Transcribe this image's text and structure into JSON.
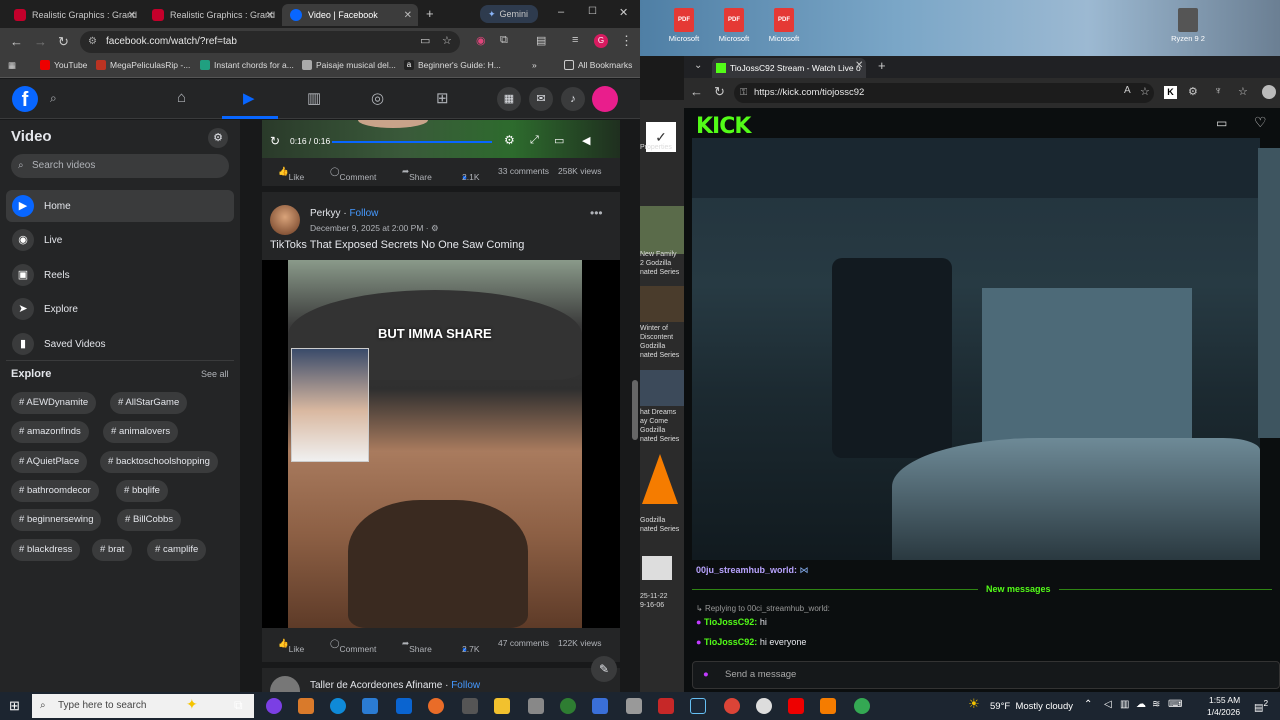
{
  "left_browser": {
    "tabs": [
      {
        "label": "Realistic Graphics : Grand",
        "color": "#c4002b"
      },
      {
        "label": "Realistic Graphics : Grand",
        "color": "#c4002b"
      },
      {
        "label": "Video | Facebook",
        "color": "#0866ff"
      },
      {
        "label": "Gemini",
        "color": "#4285f4"
      }
    ],
    "url": "facebook.com/watch/?ref=tab",
    "bookmarks": [
      "YouTube",
      "MegaPeliculasRip -...",
      "Instant chords for a...",
      "Paisaje musical del...",
      "Beginner's Guide: H..."
    ],
    "all_bookmarks": "All Bookmarks"
  },
  "sidebar": {
    "title": "Video",
    "search_placeholder": "Search videos",
    "items": [
      {
        "label": "Home",
        "icon": "play-icon"
      },
      {
        "label": "Live",
        "icon": "live-icon"
      },
      {
        "label": "Reels",
        "icon": "reels-icon"
      },
      {
        "label": "Explore",
        "icon": "explore-icon"
      },
      {
        "label": "Saved Videos",
        "icon": "bookmark-icon"
      }
    ],
    "explore_title": "Explore",
    "see_all": "See all",
    "tags": [
      "AEWDynamite",
      "AllStarGame",
      "amazonfinds",
      "animalovers",
      "AQuietPlace",
      "backtoschoolshopping",
      "bathroomdecor",
      "bbqlife",
      "beginnersewing",
      "BillCobbs",
      "blackdress",
      "brat",
      "camplife"
    ]
  },
  "feed": {
    "video_time": "0:16 / 0:16",
    "post1": {
      "like": "Like",
      "comment": "Comment",
      "share": "Share",
      "reactions": "2.1K",
      "comments": "33 comments",
      "views": "258K views"
    },
    "post2": {
      "author": "Perkyy",
      "follow": "Follow",
      "date": "December 9, 2025 at 2:00 PM",
      "title": "TikToks That Exposed Secrets No One Saw Coming",
      "caption": "BUT IMMA SHARE",
      "like": "Like",
      "comment": "Comment",
      "share": "Share",
      "reactions": "2.7K",
      "comments": "47 comments",
      "views": "122K views"
    },
    "post3": {
      "author": "Taller de Acordeones Afiname",
      "follow": "Follow"
    }
  },
  "desktop": {
    "icons": [
      "Microsoft",
      "Microsoft",
      "Microsoft"
    ],
    "ryzen": "Ryzen 9 2"
  },
  "mid_strip": {
    "props": "Properties",
    "items": [
      "New Family\n2 Godzilla\nnated Series",
      "Winter of\nDiscontent\nGodzilla\nnated Series",
      "hat Dreams\nay Come\nGodzilla\nnated Series",
      "Godzilla\nnated Series",
      "25-11-22\n9-16-06"
    ]
  },
  "right_browser": {
    "tab": "TioJossC92 Stream - Watch Live o",
    "url": "https://kick.com/tiojossc92",
    "logo": "KICK",
    "chat": {
      "first_user": "00ju_streamhub_world:",
      "new_messages": "New messages",
      "reply": "Replying to 00ci_streamhub_world:",
      "messages": [
        {
          "user": "TioJossC92:",
          "text": "hi"
        },
        {
          "user": "TioJossC92:",
          "text": "hi everyone"
        }
      ],
      "placeholder": "Send a message"
    }
  },
  "taskbar": {
    "search": "Type here to search",
    "weather": "59°F  Mostly cloudy",
    "time": "1:55 AM",
    "date": "1/4/2026",
    "notif": "2"
  }
}
